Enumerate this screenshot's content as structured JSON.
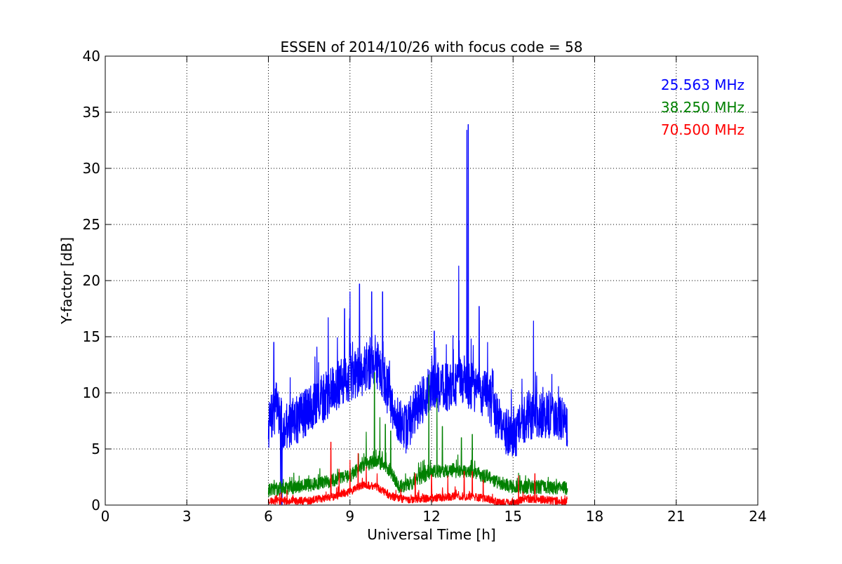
{
  "chart_data": {
    "type": "line",
    "title": "ESSEN of 2014/10/26 with focus code = 58",
    "xlabel": "Universal Time [h]",
    "ylabel": "Y-factor [dB]",
    "xlim": [
      0,
      24
    ],
    "ylim": [
      0,
      40
    ],
    "xticks": [
      0,
      3,
      6,
      9,
      12,
      15,
      18,
      21,
      24
    ],
    "yticks": [
      0,
      5,
      10,
      15,
      20,
      25,
      30,
      35,
      40
    ],
    "grid": true,
    "legend_position": "top-right",
    "series": [
      {
        "name": "25.563 MHz",
        "color": "#0000ff",
        "baseline": [
          [
            6.0,
            7.0
          ],
          [
            6.3,
            9.0
          ],
          [
            6.5,
            7.0
          ],
          [
            7.0,
            7.5
          ],
          [
            7.5,
            8.5
          ],
          [
            8.0,
            9.5
          ],
          [
            8.5,
            10.5
          ],
          [
            9.0,
            11.5
          ],
          [
            9.5,
            12.0
          ],
          [
            10.0,
            12.5
          ],
          [
            10.3,
            11.0
          ],
          [
            10.6,
            8.0
          ],
          [
            11.0,
            6.5
          ],
          [
            11.5,
            9.0
          ],
          [
            12.0,
            10.5
          ],
          [
            12.5,
            10.5
          ],
          [
            13.0,
            11.0
          ],
          [
            13.5,
            10.5
          ],
          [
            14.0,
            10.0
          ],
          [
            14.3,
            8.5
          ],
          [
            14.6,
            7.0
          ],
          [
            15.0,
            6.0
          ],
          [
            15.5,
            8.0
          ],
          [
            16.0,
            8.0
          ],
          [
            16.5,
            8.0
          ],
          [
            17.0,
            7.0
          ]
        ],
        "spikes": [
          [
            6.2,
            14.5
          ],
          [
            6.45,
            1.0
          ],
          [
            6.5,
            0.0
          ],
          [
            8.2,
            16.7
          ],
          [
            8.8,
            17.5
          ],
          [
            9.0,
            19.0
          ],
          [
            9.35,
            19.7
          ],
          [
            9.8,
            19.0
          ],
          [
            10.2,
            19.0
          ],
          [
            12.1,
            15.5
          ],
          [
            13.0,
            21.3
          ],
          [
            13.3,
            33.4
          ],
          [
            13.35,
            33.9
          ],
          [
            13.75,
            17.7
          ],
          [
            15.75,
            16.4
          ],
          [
            16.7,
            9.5
          ]
        ],
        "noise": 2.2,
        "seed": 7
      },
      {
        "name": "38.250 MHz",
        "color": "#008000",
        "baseline": [
          [
            6.0,
            1.3
          ],
          [
            7.0,
            1.6
          ],
          [
            8.0,
            2.0
          ],
          [
            9.0,
            2.6
          ],
          [
            9.5,
            3.5
          ],
          [
            10.0,
            4.0
          ],
          [
            10.5,
            3.0
          ],
          [
            10.8,
            1.6
          ],
          [
            11.3,
            2.0
          ],
          [
            12.0,
            3.0
          ],
          [
            13.0,
            3.0
          ],
          [
            13.5,
            3.0
          ],
          [
            14.0,
            2.5
          ],
          [
            14.5,
            2.0
          ],
          [
            15.0,
            1.6
          ],
          [
            16.0,
            1.6
          ],
          [
            17.0,
            1.5
          ]
        ],
        "spikes": [
          [
            9.6,
            6.5
          ],
          [
            9.9,
            11.8
          ],
          [
            10.1,
            7.8
          ],
          [
            10.3,
            7.2
          ],
          [
            10.5,
            6.6
          ],
          [
            11.9,
            11.6
          ],
          [
            12.2,
            9.5
          ],
          [
            12.4,
            7.0
          ],
          [
            13.1,
            6.0
          ],
          [
            13.5,
            6.3
          ]
        ],
        "noise": 0.6,
        "seed": 13
      },
      {
        "name": "70.500 MHz",
        "color": "#ff0000",
        "baseline": [
          [
            6.0,
            0.4
          ],
          [
            7.0,
            0.4
          ],
          [
            7.5,
            0.4
          ],
          [
            8.0,
            0.6
          ],
          [
            8.5,
            0.8
          ],
          [
            9.0,
            1.2
          ],
          [
            9.5,
            1.8
          ],
          [
            10.0,
            1.6
          ],
          [
            10.5,
            0.8
          ],
          [
            11.0,
            0.5
          ],
          [
            12.0,
            0.6
          ],
          [
            12.5,
            0.7
          ],
          [
            13.0,
            0.8
          ],
          [
            13.5,
            0.7
          ],
          [
            14.0,
            0.6
          ],
          [
            14.5,
            0.2
          ],
          [
            15.0,
            0.2
          ],
          [
            15.5,
            0.6
          ],
          [
            16.0,
            0.5
          ],
          [
            17.0,
            0.3
          ]
        ],
        "spikes": [
          [
            8.3,
            5.6
          ],
          [
            8.6,
            3.2
          ],
          [
            9.0,
            4.0
          ],
          [
            9.3,
            4.6
          ],
          [
            9.6,
            3.4
          ],
          [
            10.0,
            2.8
          ],
          [
            11.4,
            2.8
          ],
          [
            12.0,
            2.7
          ],
          [
            12.6,
            2.6
          ],
          [
            13.2,
            3.0
          ],
          [
            13.5,
            3.0
          ],
          [
            13.9,
            2.2
          ],
          [
            15.2,
            2.6
          ],
          [
            15.8,
            2.8
          ]
        ],
        "noise": 0.35,
        "seed": 23
      }
    ]
  }
}
